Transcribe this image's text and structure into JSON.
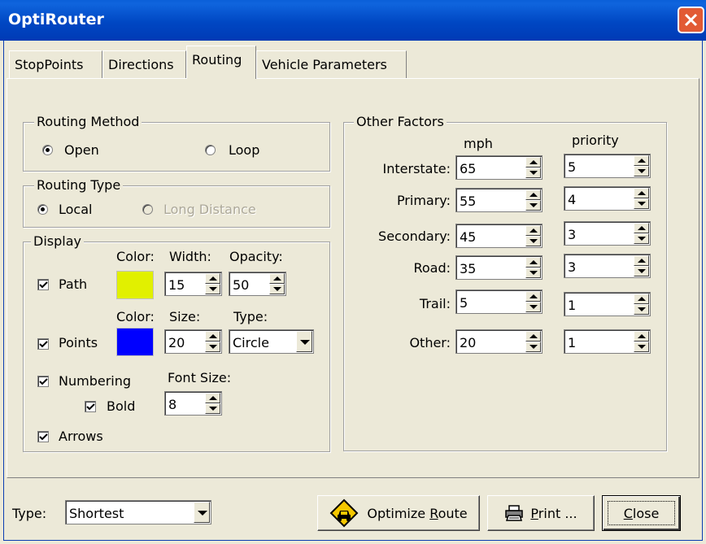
{
  "window": {
    "title": "OptiRouter"
  },
  "tabs": [
    "StopPoints",
    "Directions",
    "Routing",
    "Vehicle Parameters"
  ],
  "routing_method": {
    "label": "Routing Method",
    "options": [
      "Open",
      "Loop"
    ],
    "selected": "Open"
  },
  "routing_type": {
    "label": "Routing Type",
    "options": [
      "Local",
      "Long Distance"
    ],
    "selected": "Local"
  },
  "display": {
    "label": "Display",
    "path": {
      "label": "Path",
      "checked": true,
      "color_label": "Color:",
      "color": "#e1f000",
      "width_label": "Width:",
      "width": "15",
      "opacity_label": "Opacity:",
      "opacity": "50"
    },
    "points": {
      "label": "Points",
      "checked": true,
      "color_label": "Color:",
      "color": "#0000ff",
      "size_label": "Size:",
      "size": "20",
      "type_label": "Type:",
      "type": "Circle"
    },
    "numbering": {
      "label": "Numbering",
      "checked": true
    },
    "bold": {
      "label": "Bold",
      "checked": true
    },
    "font_size": {
      "label": "Font Size:",
      "value": "8"
    },
    "arrows": {
      "label": "Arrows",
      "checked": true
    }
  },
  "other_factors": {
    "label": "Other Factors",
    "mph_header": "mph",
    "priority_header": "priority",
    "rows": [
      {
        "label": "Interstate:",
        "mph": "65",
        "priority": "5"
      },
      {
        "label": "Primary:",
        "mph": "55",
        "priority": "4"
      },
      {
        "label": "Secondary:",
        "mph": "45",
        "priority": "3"
      },
      {
        "label": "Road:",
        "mph": "35",
        "priority": "3"
      },
      {
        "label": "Trail:",
        "mph": "5",
        "priority": "1"
      },
      {
        "label": "Other:",
        "mph": "20",
        "priority": "1"
      }
    ]
  },
  "footer": {
    "type_label": "Type:",
    "type_value": "Shortest",
    "optimize_label_pre": "Optimize ",
    "optimize_label_key": "R",
    "optimize_label_post": "oute",
    "print_key": "P",
    "print_post": "rint ...",
    "close_key": "C",
    "close_post": "lose"
  },
  "icons": [
    "close-x-icon",
    "car-warning-sign-icon",
    "printer-icon",
    "checkmark-icon",
    "spin-up-icon",
    "spin-down-icon",
    "dropdown-arrow-icon"
  ]
}
